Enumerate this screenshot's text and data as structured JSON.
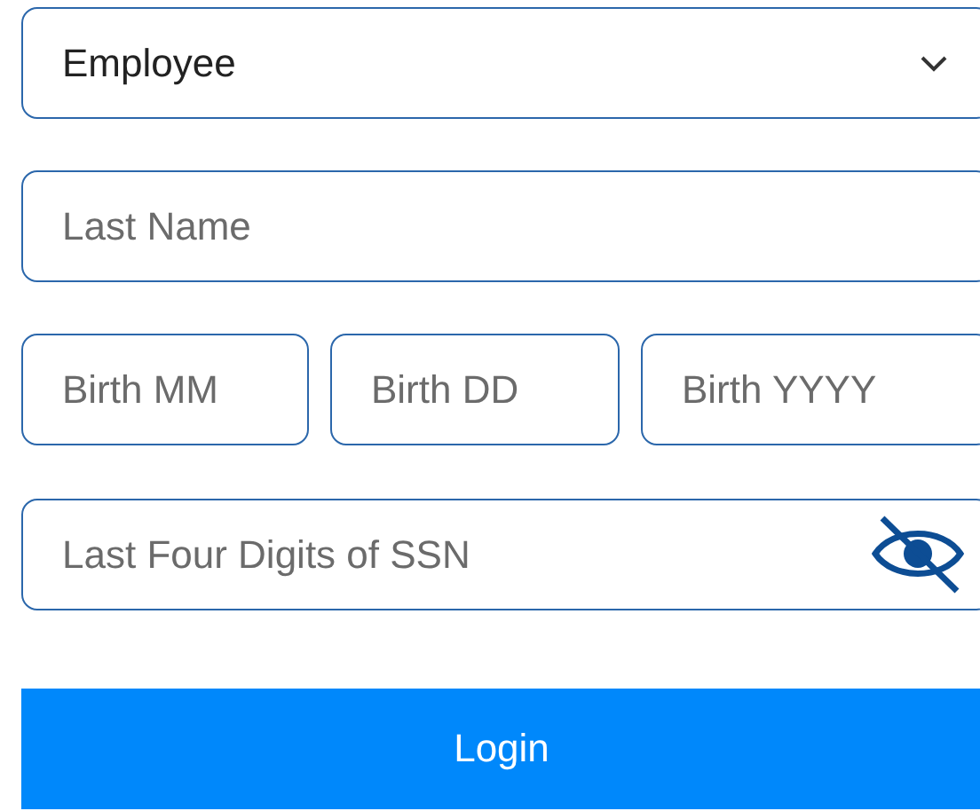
{
  "role_select": {
    "value": "Employee"
  },
  "last_name": {
    "placeholder": "Last Name"
  },
  "birth_fields": [
    {
      "placeholder": "Birth MM"
    },
    {
      "placeholder": "Birth DD"
    },
    {
      "placeholder": "Birth YYYY"
    }
  ],
  "ssn": {
    "placeholder": "Last Four Digits of SSN",
    "show_value": false
  },
  "login_button": "Login"
}
